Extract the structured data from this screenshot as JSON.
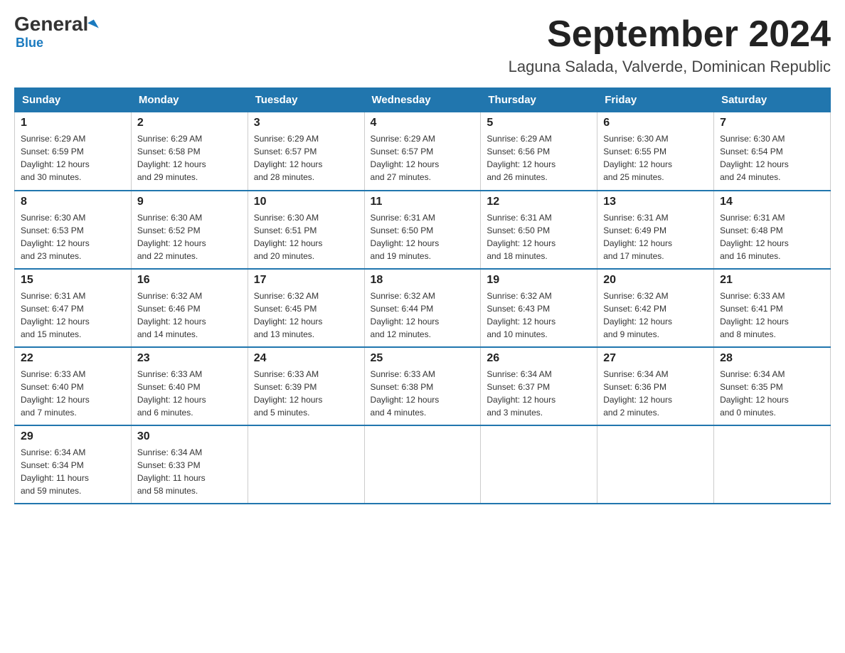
{
  "header": {
    "logo_general": "General",
    "logo_blue": "Blue",
    "title": "September 2024",
    "subtitle": "Laguna Salada, Valverde, Dominican Republic"
  },
  "weekdays": [
    "Sunday",
    "Monday",
    "Tuesday",
    "Wednesday",
    "Thursday",
    "Friday",
    "Saturday"
  ],
  "weeks": [
    [
      {
        "day": "1",
        "sunrise": "6:29 AM",
        "sunset": "6:59 PM",
        "daylight": "12 hours and 30 minutes."
      },
      {
        "day": "2",
        "sunrise": "6:29 AM",
        "sunset": "6:58 PM",
        "daylight": "12 hours and 29 minutes."
      },
      {
        "day": "3",
        "sunrise": "6:29 AM",
        "sunset": "6:57 PM",
        "daylight": "12 hours and 28 minutes."
      },
      {
        "day": "4",
        "sunrise": "6:29 AM",
        "sunset": "6:57 PM",
        "daylight": "12 hours and 27 minutes."
      },
      {
        "day": "5",
        "sunrise": "6:29 AM",
        "sunset": "6:56 PM",
        "daylight": "12 hours and 26 minutes."
      },
      {
        "day": "6",
        "sunrise": "6:30 AM",
        "sunset": "6:55 PM",
        "daylight": "12 hours and 25 minutes."
      },
      {
        "day": "7",
        "sunrise": "6:30 AM",
        "sunset": "6:54 PM",
        "daylight": "12 hours and 24 minutes."
      }
    ],
    [
      {
        "day": "8",
        "sunrise": "6:30 AM",
        "sunset": "6:53 PM",
        "daylight": "12 hours and 23 minutes."
      },
      {
        "day": "9",
        "sunrise": "6:30 AM",
        "sunset": "6:52 PM",
        "daylight": "12 hours and 22 minutes."
      },
      {
        "day": "10",
        "sunrise": "6:30 AM",
        "sunset": "6:51 PM",
        "daylight": "12 hours and 20 minutes."
      },
      {
        "day": "11",
        "sunrise": "6:31 AM",
        "sunset": "6:50 PM",
        "daylight": "12 hours and 19 minutes."
      },
      {
        "day": "12",
        "sunrise": "6:31 AM",
        "sunset": "6:50 PM",
        "daylight": "12 hours and 18 minutes."
      },
      {
        "day": "13",
        "sunrise": "6:31 AM",
        "sunset": "6:49 PM",
        "daylight": "12 hours and 17 minutes."
      },
      {
        "day": "14",
        "sunrise": "6:31 AM",
        "sunset": "6:48 PM",
        "daylight": "12 hours and 16 minutes."
      }
    ],
    [
      {
        "day": "15",
        "sunrise": "6:31 AM",
        "sunset": "6:47 PM",
        "daylight": "12 hours and 15 minutes."
      },
      {
        "day": "16",
        "sunrise": "6:32 AM",
        "sunset": "6:46 PM",
        "daylight": "12 hours and 14 minutes."
      },
      {
        "day": "17",
        "sunrise": "6:32 AM",
        "sunset": "6:45 PM",
        "daylight": "12 hours and 13 minutes."
      },
      {
        "day": "18",
        "sunrise": "6:32 AM",
        "sunset": "6:44 PM",
        "daylight": "12 hours and 12 minutes."
      },
      {
        "day": "19",
        "sunrise": "6:32 AM",
        "sunset": "6:43 PM",
        "daylight": "12 hours and 10 minutes."
      },
      {
        "day": "20",
        "sunrise": "6:32 AM",
        "sunset": "6:42 PM",
        "daylight": "12 hours and 9 minutes."
      },
      {
        "day": "21",
        "sunrise": "6:33 AM",
        "sunset": "6:41 PM",
        "daylight": "12 hours and 8 minutes."
      }
    ],
    [
      {
        "day": "22",
        "sunrise": "6:33 AM",
        "sunset": "6:40 PM",
        "daylight": "12 hours and 7 minutes."
      },
      {
        "day": "23",
        "sunrise": "6:33 AM",
        "sunset": "6:40 PM",
        "daylight": "12 hours and 6 minutes."
      },
      {
        "day": "24",
        "sunrise": "6:33 AM",
        "sunset": "6:39 PM",
        "daylight": "12 hours and 5 minutes."
      },
      {
        "day": "25",
        "sunrise": "6:33 AM",
        "sunset": "6:38 PM",
        "daylight": "12 hours and 4 minutes."
      },
      {
        "day": "26",
        "sunrise": "6:34 AM",
        "sunset": "6:37 PM",
        "daylight": "12 hours and 3 minutes."
      },
      {
        "day": "27",
        "sunrise": "6:34 AM",
        "sunset": "6:36 PM",
        "daylight": "12 hours and 2 minutes."
      },
      {
        "day": "28",
        "sunrise": "6:34 AM",
        "sunset": "6:35 PM",
        "daylight": "12 hours and 0 minutes."
      }
    ],
    [
      {
        "day": "29",
        "sunrise": "6:34 AM",
        "sunset": "6:34 PM",
        "daylight": "11 hours and 59 minutes."
      },
      {
        "day": "30",
        "sunrise": "6:34 AM",
        "sunset": "6:33 PM",
        "daylight": "11 hours and 58 minutes."
      },
      null,
      null,
      null,
      null,
      null
    ]
  ],
  "labels": {
    "sunrise": "Sunrise:",
    "sunset": "Sunset:",
    "daylight": "Daylight:"
  }
}
